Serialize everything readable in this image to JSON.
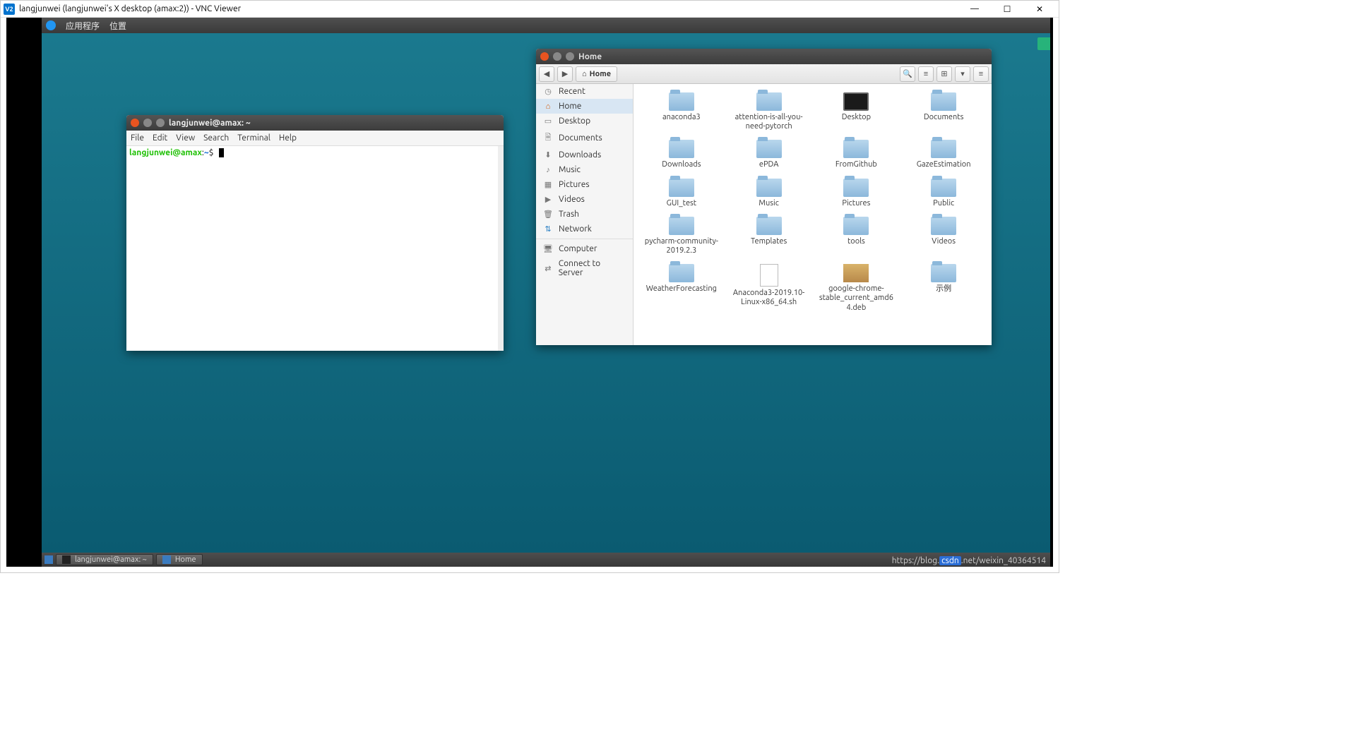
{
  "vnc": {
    "icon_text": "V2",
    "title": "langjunwei (langjunwei's X desktop (amax:2)) - VNC Viewer",
    "minimize": "—",
    "maximize": "☐",
    "close": "✕"
  },
  "xfce_panel": {
    "apps": "应用程序",
    "places": "位置"
  },
  "terminal": {
    "title": "langjunwei@amax: ~",
    "menu": [
      "File",
      "Edit",
      "View",
      "Search",
      "Terminal",
      "Help"
    ],
    "prompt_user": "langjunwei@amax",
    "prompt_sep": ":",
    "prompt_path": "~",
    "prompt_end": "$"
  },
  "fm": {
    "title": "Home",
    "toolbar": {
      "back": "◀",
      "forward": "▶",
      "home_icon": "⌂",
      "home_label": "Home",
      "search": "🔍",
      "list": "≡",
      "grid": "⊞",
      "down": "▾",
      "menu": "≡"
    },
    "side": {
      "recent": "Recent",
      "home": "Home",
      "desktop": "Desktop",
      "documents": "Documents",
      "downloads": "Downloads",
      "music": "Music",
      "pictures": "Pictures",
      "videos": "Videos",
      "trash": "Trash",
      "network": "Network",
      "computer": "Computer",
      "connect": "Connect to Server"
    },
    "items": [
      {
        "label": "anaconda3",
        "type": "folder"
      },
      {
        "label": "attention-is-all-you-need-pytorch",
        "type": "folder"
      },
      {
        "label": "Desktop",
        "type": "desktop"
      },
      {
        "label": "Documents",
        "type": "folder"
      },
      {
        "label": "Downloads",
        "type": "folder"
      },
      {
        "label": "ePDA",
        "type": "folder"
      },
      {
        "label": "FromGithub",
        "type": "folder"
      },
      {
        "label": "GazeEstimation",
        "type": "folder"
      },
      {
        "label": "GUI_test",
        "type": "folder"
      },
      {
        "label": "Music",
        "type": "folder"
      },
      {
        "label": "Pictures",
        "type": "folder"
      },
      {
        "label": "Public",
        "type": "folder"
      },
      {
        "label": "pycharm-community-2019.2.3",
        "type": "folder"
      },
      {
        "label": "Templates",
        "type": "folder"
      },
      {
        "label": "tools",
        "type": "folder"
      },
      {
        "label": "Videos",
        "type": "folder"
      },
      {
        "label": "WeatherForecasting",
        "type": "folder"
      },
      {
        "label": "Anaconda3-2019.10-Linux-x86_64.sh",
        "type": "file"
      },
      {
        "label": "google-chrome-stable_current_amd64.deb",
        "type": "deb"
      },
      {
        "label": "示例",
        "type": "folder"
      }
    ]
  },
  "taskbar": {
    "task1": "langjunwei@amax: ~",
    "task2": "Home"
  },
  "watermark": {
    "text_a": "https://blog.",
    "mark": "csdn",
    "text_b": ".net/weixin_40364514"
  }
}
